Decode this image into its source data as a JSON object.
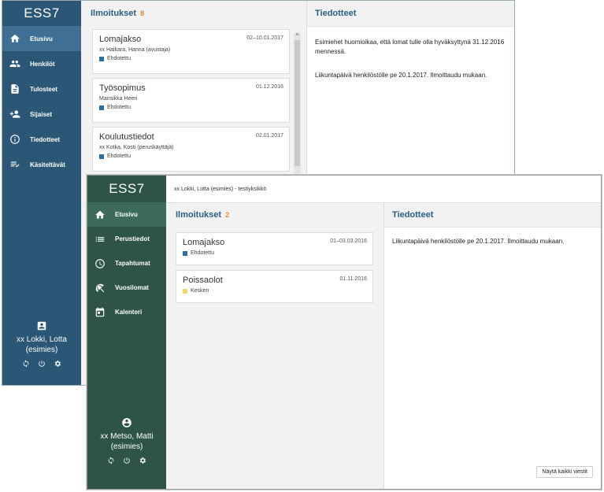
{
  "window1": {
    "logo": "ESS7",
    "nav": [
      {
        "label": "Etusivu",
        "icon": "home-icon",
        "active": true
      },
      {
        "label": "Henkilöt",
        "icon": "people-icon"
      },
      {
        "label": "Tulosteet",
        "icon": "document-icon"
      },
      {
        "label": "Sijaiset",
        "icon": "add-person-icon"
      },
      {
        "label": "Tiedotteet",
        "icon": "info-icon"
      },
      {
        "label": "Käsiteltävät",
        "icon": "checklist-icon"
      }
    ],
    "user": {
      "name": "xx Lokki, Lotta",
      "role": "(esimies)"
    },
    "ilmoitukset": {
      "title": "Ilmoitukset",
      "count": "8",
      "cards": [
        {
          "title": "Lomajakso",
          "date": "02–10.01.2017",
          "person": "xx Haikara, Hanna (avustaja)",
          "status": "Ehdotettu"
        },
        {
          "title": "Työsopimus",
          "date": "01.12.2016",
          "person": "Mansikka Heeri",
          "status": "Ehdotettu"
        },
        {
          "title": "Koulutustiedot",
          "date": "02.01.2017",
          "person": "xx Kotka, Kosti (peruskäyttäjä)",
          "status": "Ehdotettu"
        }
      ]
    },
    "tiedotteet": {
      "title": "Tiedotteet",
      "items": [
        "Esimiehet huomioikaa, että lomat tulle olla hyväksyttynä 31.12.2016 mennessä.",
        "Liikuntapäivä henkilöstölle pe 20.1.2017. Ilmoittaudu mukaan."
      ]
    }
  },
  "window2": {
    "logo": "ESS7",
    "topbar": "xx Lokki, Lotta (esimies) - testiyksikkö",
    "nav": [
      {
        "label": "Etusivu",
        "icon": "home-icon",
        "active": true
      },
      {
        "label": "Perustiedot",
        "icon": "list-icon"
      },
      {
        "label": "Tapahtumat",
        "icon": "clock-icon"
      },
      {
        "label": "Vuosilomat",
        "icon": "beach-umbrella-icon"
      },
      {
        "label": "Kalenteri",
        "icon": "calendar-icon"
      }
    ],
    "user": {
      "name": "xx Metso, Matti",
      "role": "(esimies)"
    },
    "ilmoitukset": {
      "title": "Ilmoitukset",
      "count": "2",
      "cards": [
        {
          "title": "Lomajakso",
          "date": "01–03.03.2016",
          "status": "Ehdotettu"
        },
        {
          "title": "Poissaolot",
          "date": "01.11.2016",
          "status": "Kesken"
        }
      ]
    },
    "tiedotteet": {
      "title": "Tiedotteet",
      "items": [
        "Liikuntapäivä henkilöstölle pe 20.1.2017. Ilmoittaudu mukaan."
      ],
      "show_all": "Näytä kaikki viestit"
    }
  },
  "colors": {
    "sidebar1": "#2b5676",
    "sidebar2": "#2e5446",
    "status_ehdotettu": "#2f6ea3",
    "status_kesken": "#f5d76e",
    "badge": "#e98a2b",
    "title": "#2b5d80"
  }
}
